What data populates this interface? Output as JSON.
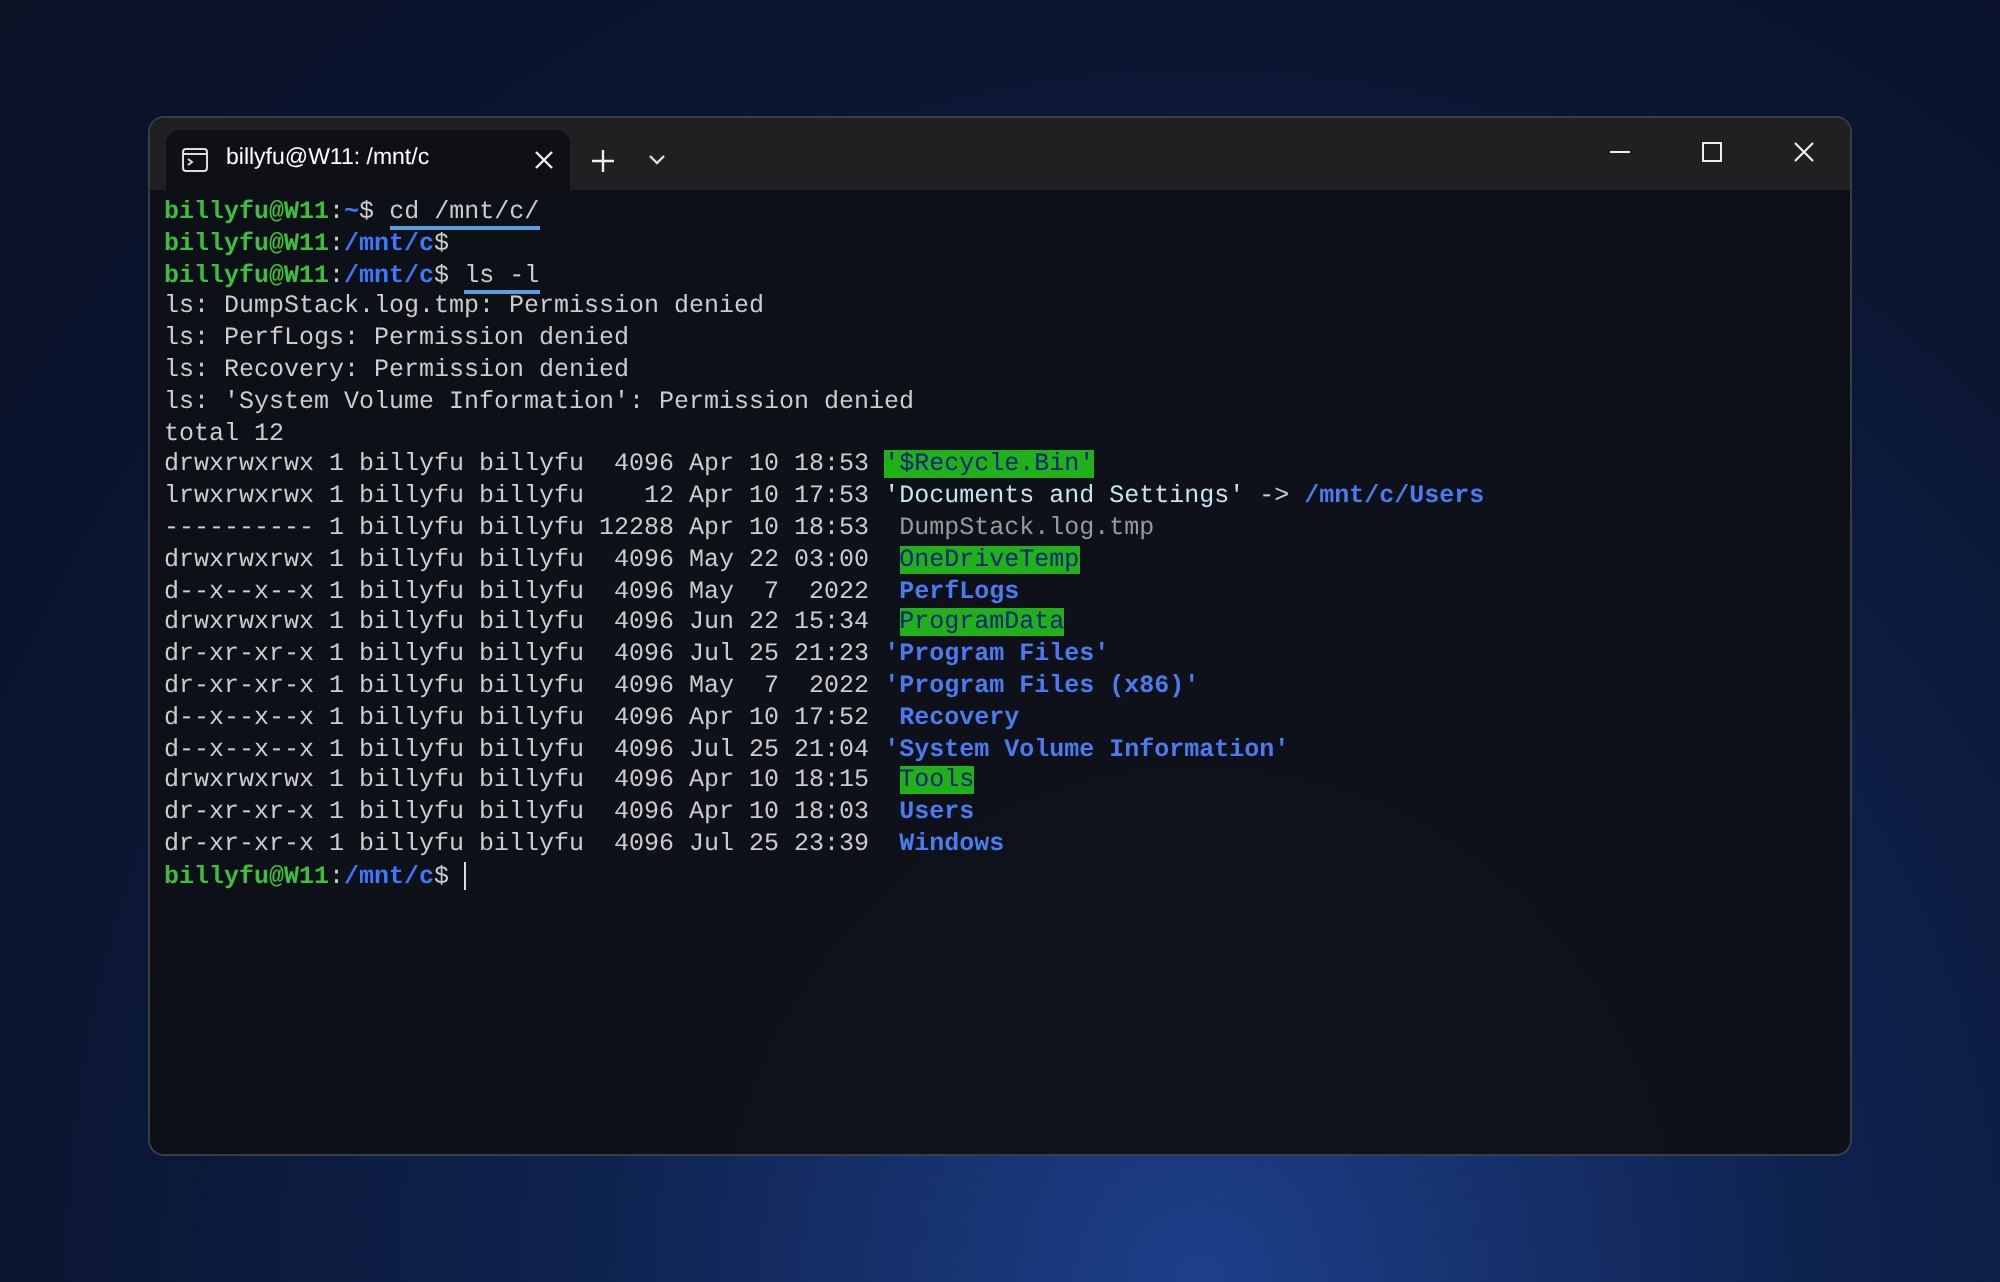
{
  "window": {
    "tabs": [
      {
        "title": "billyfu@W11: /mnt/c",
        "selected": true
      }
    ]
  },
  "terminal": {
    "cursor": true,
    "lines": [
      [
        {
          "kind": "user",
          "text": "billyfu@W11"
        },
        {
          "kind": "plain",
          "text": ":"
        },
        {
          "kind": "path",
          "text": "~"
        },
        {
          "kind": "plain",
          "text": "$ "
        },
        {
          "kind": "command",
          "text": "cd /mnt/c/"
        }
      ],
      [
        {
          "kind": "user",
          "text": "billyfu@W11"
        },
        {
          "kind": "plain",
          "text": ":"
        },
        {
          "kind": "path",
          "text": "/mnt/c"
        },
        {
          "kind": "plain",
          "text": "$"
        }
      ],
      [
        {
          "kind": "user",
          "text": "billyfu@W11"
        },
        {
          "kind": "plain",
          "text": ":"
        },
        {
          "kind": "path",
          "text": "/mnt/c"
        },
        {
          "kind": "plain",
          "text": "$ "
        },
        {
          "kind": "command",
          "text": "ls -l"
        }
      ],
      [
        {
          "kind": "plain",
          "text": "ls: DumpStack.log.tmp: Permission denied"
        }
      ],
      [
        {
          "kind": "plain",
          "text": "ls: PerfLogs: Permission denied"
        }
      ],
      [
        {
          "kind": "plain",
          "text": "ls: Recovery: Permission denied"
        }
      ],
      [
        {
          "kind": "plain",
          "text": "ls: 'System Volume Information': Permission denied"
        }
      ],
      [
        {
          "kind": "plain",
          "text": "total 12"
        }
      ],
      [
        {
          "kind": "plain",
          "text": "drwxrwxrwx 1 billyfu billyfu  4096 Apr 10 18:53 "
        },
        {
          "kind": "dir-highlight",
          "text": "'$Recycle.Bin'"
        }
      ],
      [
        {
          "kind": "plain",
          "text": "lrwxrwxrwx 1 billyfu billyfu    12 Apr 10 17:53 "
        },
        {
          "kind": "link",
          "text": "'Documents and Settings'"
        },
        {
          "kind": "plain",
          "text": " -> "
        },
        {
          "kind": "dir",
          "text": "/mnt/c/Users"
        }
      ],
      [
        {
          "kind": "plain",
          "text": "---------- 1 billyfu billyfu 12288 Apr 10 18:53  "
        },
        {
          "kind": "dim",
          "text": "DumpStack.log.tmp"
        }
      ],
      [
        {
          "kind": "plain",
          "text": "drwxrwxrwx 1 billyfu billyfu  4096 May 22 03:00  "
        },
        {
          "kind": "dir-highlight",
          "text": "OneDriveTemp"
        }
      ],
      [
        {
          "kind": "plain",
          "text": "d--x--x--x 1 billyfu billyfu  4096 May  7  2022  "
        },
        {
          "kind": "dir",
          "text": "PerfLogs"
        }
      ],
      [
        {
          "kind": "plain",
          "text": "drwxrwxrwx 1 billyfu billyfu  4096 Jun 22 15:34  "
        },
        {
          "kind": "dir-highlight",
          "text": "ProgramData"
        }
      ],
      [
        {
          "kind": "plain",
          "text": "dr-xr-xr-x 1 billyfu billyfu  4096 Jul 25 21:23 "
        },
        {
          "kind": "dir",
          "text": "'Program Files'"
        }
      ],
      [
        {
          "kind": "plain",
          "text": "dr-xr-xr-x 1 billyfu billyfu  4096 May  7  2022 "
        },
        {
          "kind": "dir",
          "text": "'Program Files (x86)'"
        }
      ],
      [
        {
          "kind": "plain",
          "text": "d--x--x--x 1 billyfu billyfu  4096 Apr 10 17:52  "
        },
        {
          "kind": "dir",
          "text": "Recovery"
        }
      ],
      [
        {
          "kind": "plain",
          "text": "d--x--x--x 1 billyfu billyfu  4096 Jul 25 21:04 "
        },
        {
          "kind": "dir",
          "text": "'System Volume Information'"
        }
      ],
      [
        {
          "kind": "plain",
          "text": "drwxrwxrwx 1 billyfu billyfu  4096 Apr 10 18:15  "
        },
        {
          "kind": "dir-highlight",
          "text": "Tools"
        }
      ],
      [
        {
          "kind": "plain",
          "text": "dr-xr-xr-x 1 billyfu billyfu  4096 Apr 10 18:03  "
        },
        {
          "kind": "dir",
          "text": "Users"
        }
      ],
      [
        {
          "kind": "plain",
          "text": "dr-xr-xr-x 1 billyfu billyfu  4096 Jul 25 23:39  "
        },
        {
          "kind": "dir",
          "text": "Windows"
        }
      ],
      [
        {
          "kind": "user",
          "text": "billyfu@W11"
        },
        {
          "kind": "plain",
          "text": ":"
        },
        {
          "kind": "path",
          "text": "/mnt/c"
        },
        {
          "kind": "plain",
          "text": "$ "
        }
      ]
    ]
  }
}
